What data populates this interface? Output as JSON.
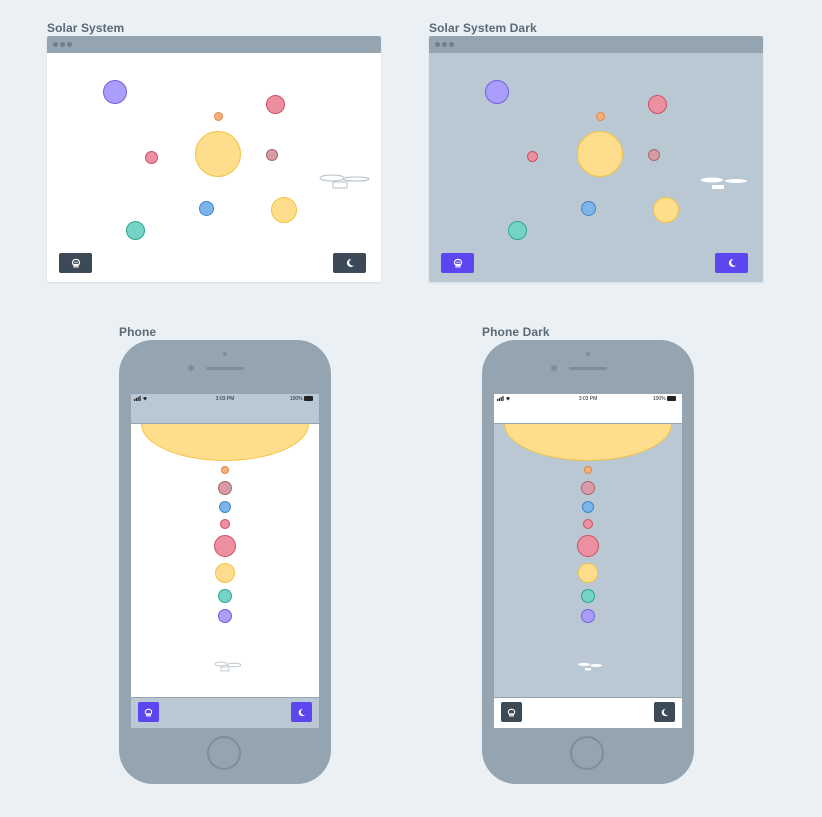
{
  "frames": {
    "solar_light": {
      "title": "Solar System"
    },
    "solar_dark": {
      "title": "Solar System Dark"
    },
    "phone_light": {
      "title": "Phone"
    },
    "phone_dark": {
      "title": "Phone Dark"
    }
  },
  "status_bar": {
    "time": "3:03 PM",
    "battery": "100%"
  },
  "buttons": {
    "astronaut": "astronaut-icon",
    "dark_mode": "moon-icon"
  },
  "colors": {
    "sun": "#fedd8d",
    "sun_border": "#f3c441",
    "purple": "#5d45f0",
    "slate": "#3b4a56",
    "planet_purple": "#ab9efa",
    "planet_red": "#ec8fa0",
    "planet_orange": "#f7b07d",
    "planet_mauve": "#d89aa3",
    "planet_blue": "#7db5ea",
    "planet_teal": "#74d3c4",
    "planet_yellow": "#fedd8d"
  }
}
